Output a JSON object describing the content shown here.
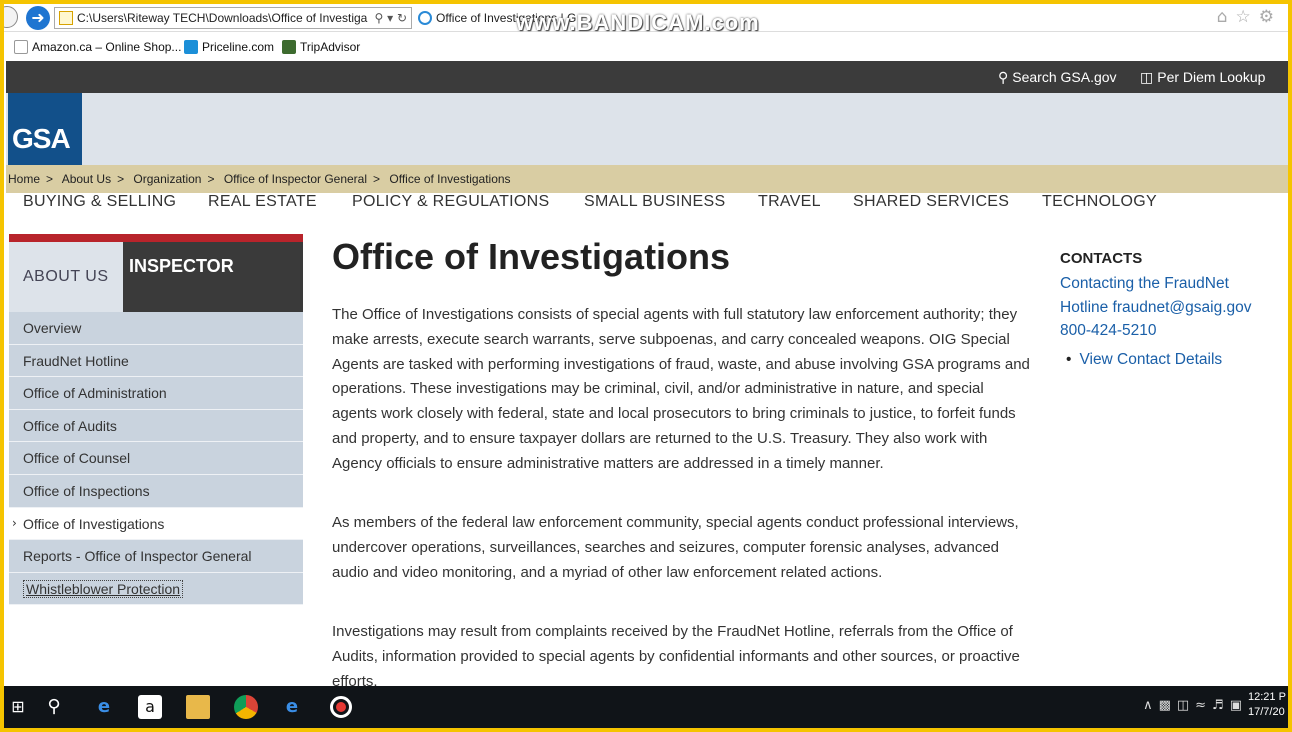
{
  "browser": {
    "url": "C:\\Users\\Riteway TECH\\Downloads\\Office of Investiga",
    "tab_title": "Office of Investigations | G",
    "watermark": "www.BANDICAM.com",
    "bookmarks": [
      {
        "label": "Amazon.ca – Online Shop..."
      },
      {
        "label": "Priceline.com"
      },
      {
        "label": "TripAdvisor"
      }
    ]
  },
  "topbar": {
    "search_label": "Search GSA.gov",
    "perdiem_label": "Per Diem Lookup"
  },
  "logo": {
    "text": "GSA"
  },
  "breadcrumb": [
    "Home",
    "About Us",
    "Organization",
    "Office of Inspector General",
    "Office of Investigations"
  ],
  "main_nav": [
    "BUYING & SELLING",
    "REAL ESTATE",
    "POLICY & REGULATIONS",
    "SMALL BUSINESS",
    "TRAVEL",
    "SHARED SERVICES",
    "TECHNOLOGY"
  ],
  "sidebar": {
    "about_label": "ABOUT US",
    "title": "INSPECTOR",
    "items": [
      {
        "label": "Overview"
      },
      {
        "label": "FraudNet Hotline"
      },
      {
        "label": "Office of Administration"
      },
      {
        "label": "Office of Audits"
      },
      {
        "label": "Office of Counsel"
      },
      {
        "label": "Office of Inspections"
      },
      {
        "label": "Office of Investigations"
      },
      {
        "label": "Reports - Office of Inspector General"
      },
      {
        "label": "Whistleblower Protection"
      }
    ]
  },
  "content": {
    "title": "Office of Investigations",
    "paragraphs": [
      "The Office of Investigations consists of special agents with full statutory law enforcement authority; they make arrests, execute search warrants, serve subpoenas, and carry concealed weapons. OIG Special Agents are tasked with performing investigations of fraud, waste, and abuse involving GSA programs and operations. These investigations may be criminal, civil, and/or administrative in nature, and special agents work closely with federal, state and local prosecutors to bring criminals to justice, to forfeit funds and property, and to ensure taxpayer dollars are returned to the U.S. Treasury. They also work with Agency officials to ensure administrative matters are addressed in a timely manner.",
      "As members of the federal law enforcement community, special agents conduct professional interviews, undercover operations, surveillances, searches and seizures, computer forensic analyses, advanced audio and video monitoring, and a myriad of other law enforcement related actions.",
      "Investigations may result from complaints received by the FraudNet Hotline, referrals from the Office of Audits, information provided to special agents by confidential informants and other sources, or proactive efforts."
    ]
  },
  "contacts": {
    "heading": "CONTACTS",
    "line1": "Contacting the FraudNet",
    "line2": "Hotline fraudnet@gsaig.gov",
    "line3": "800-424-5210",
    "details_link": "View Contact Details"
  },
  "taskbar": {
    "time": "12:21 P",
    "date": "17/7/20"
  }
}
